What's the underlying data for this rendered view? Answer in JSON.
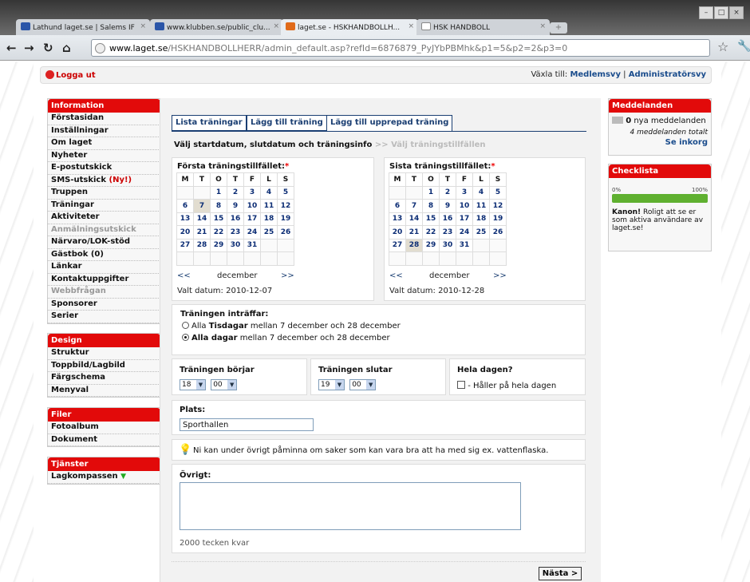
{
  "browser": {
    "tabs": [
      {
        "label": "Lathund laget.se | Salems IF",
        "icon": "kli"
      },
      {
        "label": "www.klubben.se/public_clu...",
        "icon": "kli"
      },
      {
        "label": "laget.se - HSKHANDBOLLH...",
        "icon": "laget"
      },
      {
        "label": "HSK HANDBOLL",
        "icon": "doc"
      }
    ],
    "url_domain": "www.laget.se",
    "url_path": "/HSKHANDBOLLHERR/admin_default.asp?refId=6876879_PyJYbPBMhk&p1=5&p2=2&p3=0"
  },
  "topbar": {
    "logout": "Logga ut",
    "switch_label": "Växla till:",
    "member_view": "Medlemsvy",
    "separator": "|",
    "admin_view": "Administratörsvy"
  },
  "nav": {
    "information": {
      "title": "Information",
      "items": [
        "Förstasidan",
        "Inställningar",
        "Om laget",
        "Nyheter",
        "E-postutskick",
        "SMS-utskick",
        "Truppen",
        "Träningar",
        "Aktiviteter",
        "Anmälningsutskick",
        "Närvaro/LOK-stöd",
        "Gästbok (0)",
        "Länkar",
        "Kontaktuppgifter",
        "Webbfrågan",
        "Sponsorer",
        "Serier"
      ],
      "sms_new": "(Ny!)"
    },
    "design": {
      "title": "Design",
      "items": [
        "Struktur",
        "Toppbild/Lagbild",
        "Färgschema",
        "Menyval"
      ]
    },
    "filer": {
      "title": "Filer",
      "items": [
        "Fotoalbum",
        "Dokument"
      ]
    },
    "tjanster": {
      "title": "Tjänster",
      "items": [
        "Lagkompassen"
      ]
    }
  },
  "tabs": {
    "t1": "Lista träningar",
    "t2": "Lägg till träning",
    "t3": "Lägg till upprepad träning"
  },
  "steps": {
    "s1": "Välj startdatum, slutdatum och träningsinfo",
    "sep": ">>",
    "s2": "Välj träningstillfällen"
  },
  "cal_first": {
    "title": "Första träningstillfället:",
    "req": "*",
    "prev": "<<",
    "month": "december",
    "next": ">>",
    "selected_label": "Valt datum: 2010-12-07",
    "selected_day": "7"
  },
  "cal_last": {
    "title": "Sista träningstillfället:",
    "req": "*",
    "prev": "<<",
    "month": "december",
    "next": ">>",
    "selected_label": "Valt datum: 2010-12-28",
    "selected_day": "28"
  },
  "weekdays": [
    "M",
    "T",
    "O",
    "T",
    "F",
    "L",
    "S"
  ],
  "calendar_weeks": [
    [
      "",
      "",
      "1",
      "2",
      "3",
      "4",
      "5"
    ],
    [
      "6",
      "7",
      "8",
      "9",
      "10",
      "11",
      "12"
    ],
    [
      "13",
      "14",
      "15",
      "16",
      "17",
      "18",
      "19"
    ],
    [
      "20",
      "21",
      "22",
      "23",
      "24",
      "25",
      "26"
    ],
    [
      "27",
      "28",
      "29",
      "30",
      "31",
      "",
      ""
    ],
    [
      "",
      "",
      "",
      "",
      "",
      "",
      ""
    ]
  ],
  "occurs": {
    "title": "Träningen inträffar:",
    "opt1_a": "Alla ",
    "opt1_b": "Tisdagar",
    "opt1_c": " mellan 7 december och 28 december",
    "opt2_b": "Alla dagar",
    "opt2_c": " mellan 7 december och 28 december",
    "selected": "opt2"
  },
  "times": {
    "start_label": "Träningen börjar",
    "start_h": "18",
    "start_m": "00",
    "end_label": "Träningen slutar",
    "end_h": "19",
    "end_m": "00",
    "allday_label": "Hela dagen?",
    "allday_check": "- Håller på hela dagen"
  },
  "place": {
    "label": "Plats:",
    "value": "Sporthallen"
  },
  "tip": "Ni kan under övrigt påminna om saker som kan vara bra att ha med sig ex. vattenflaska.",
  "other": {
    "label": "Övrigt:",
    "value": "",
    "remaining": "2000 tecken kvar"
  },
  "next_button": "Nästa >",
  "messages": {
    "title": "Meddelanden",
    "new_count": "0",
    "new_label": " nya meddelanden",
    "total": "4 meddelanden totalt",
    "inbox": "Se inkorg"
  },
  "checklist": {
    "title": "Checklista",
    "min": "0%",
    "max": "100%",
    "progress": 1.0,
    "bold": "Kanon!",
    "text": " Roligt att se er som aktiva användare av laget.se!"
  },
  "colors": {
    "red": "#e20a0a",
    "navy": "#1a3e72",
    "progress": "#5fb030"
  }
}
